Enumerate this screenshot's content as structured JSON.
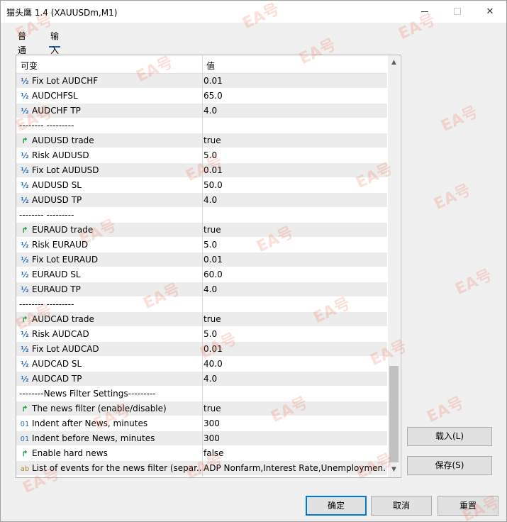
{
  "window": {
    "title": "猫头鹰 1.4 (XAUUSDm,M1)",
    "minimize_glyph": "—",
    "close_glyph": "✕"
  },
  "tabs": [
    {
      "label": "普通",
      "active": false
    },
    {
      "label": "输入",
      "active": true
    }
  ],
  "grid": {
    "col_variable": "可变",
    "col_value": "值",
    "rows": [
      {
        "icon": "double",
        "name": "Fix Lot AUDCHF",
        "value": "0.01"
      },
      {
        "icon": "double",
        "name": "AUDCHFSL",
        "value": "65.0"
      },
      {
        "icon": "double",
        "name": "AUDCHF TP",
        "value": "4.0"
      },
      {
        "icon": "none",
        "name": "--------          ---------",
        "value": ""
      },
      {
        "icon": "bool",
        "name": "AUDUSD trade",
        "value": "true"
      },
      {
        "icon": "double",
        "name": "Risk AUDUSD",
        "value": "5.0"
      },
      {
        "icon": "double",
        "name": "Fix Lot AUDUSD",
        "value": "0.01"
      },
      {
        "icon": "double",
        "name": "AUDUSD SL",
        "value": "50.0"
      },
      {
        "icon": "double",
        "name": "AUDUSD TP",
        "value": "4.0"
      },
      {
        "icon": "none",
        "name": "--------          ---------",
        "value": ""
      },
      {
        "icon": "bool",
        "name": "EURAUD trade",
        "value": "true"
      },
      {
        "icon": "double",
        "name": "Risk EURAUD",
        "value": "5.0"
      },
      {
        "icon": "double",
        "name": "Fix Lot EURAUD",
        "value": "0.01"
      },
      {
        "icon": "double",
        "name": "EURAUD SL",
        "value": "60.0"
      },
      {
        "icon": "double",
        "name": "EURAUD TP",
        "value": "4.0"
      },
      {
        "icon": "none",
        "name": "--------          ---------",
        "value": ""
      },
      {
        "icon": "bool",
        "name": "AUDCAD trade",
        "value": "true"
      },
      {
        "icon": "double",
        "name": "Risk AUDCAD",
        "value": "5.0"
      },
      {
        "icon": "double",
        "name": "Fix Lot AUDCAD",
        "value": "0.01"
      },
      {
        "icon": "double",
        "name": "AUDCAD SL",
        "value": "40.0"
      },
      {
        "icon": "double",
        "name": "AUDCAD TP",
        "value": "4.0"
      },
      {
        "icon": "none",
        "name": "--------News Filter Settings---------",
        "value": ""
      },
      {
        "icon": "bool",
        "name": "The news filter (enable/disable)",
        "value": "true"
      },
      {
        "icon": "int",
        "name": "Indent after News, minutes",
        "value": "300"
      },
      {
        "icon": "int",
        "name": "Indent before News, minutes",
        "value": "300"
      },
      {
        "icon": "bool",
        "name": "Enable hard news",
        "value": "false"
      },
      {
        "icon": "string",
        "name": "List of events for the news filter (separ...",
        "value": "ADP Nonfarm,Interest Rate,Unemploymen..."
      }
    ]
  },
  "icon_glyphs": {
    "double": "½",
    "bool": "↱",
    "int": "01",
    "string": "ab",
    "none": ""
  },
  "side_buttons": {
    "load_label": "载入(L)",
    "save_label": "保存(S)"
  },
  "buttons": {
    "ok_label": "确定",
    "cancel_label": "取消",
    "reset_label": "重置"
  },
  "watermark": {
    "text": "EA号"
  }
}
